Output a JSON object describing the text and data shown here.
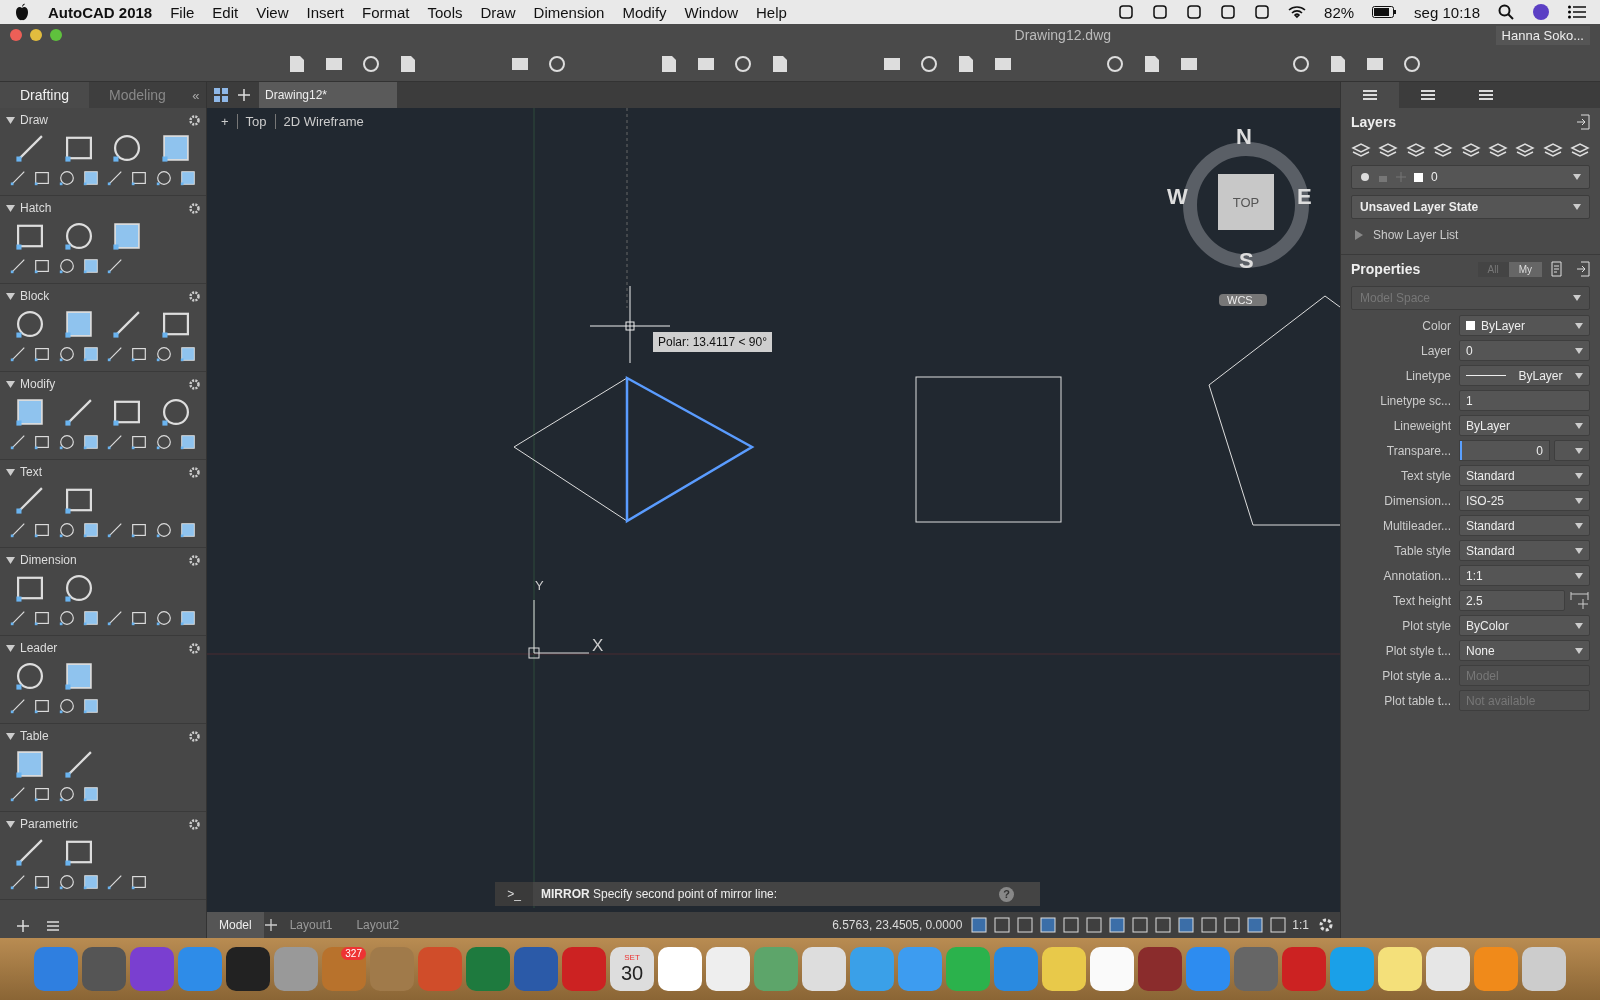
{
  "menu_bar": {
    "app": "AutoCAD 2018",
    "items": [
      "File",
      "Edit",
      "View",
      "Insert",
      "Format",
      "Tools",
      "Draw",
      "Dimension",
      "Modify",
      "Window",
      "Help"
    ],
    "battery": "82%",
    "clock": "seg 10:18"
  },
  "window": {
    "title": "Drawing12.dwg",
    "user": "Hanna Soko..."
  },
  "palette": {
    "tabs": [
      {
        "label": "Drafting",
        "selected": true
      },
      {
        "label": "Modeling",
        "selected": false
      }
    ],
    "collapse": "«",
    "sections": [
      {
        "title": "Draw",
        "expanded": true
      },
      {
        "title": "Hatch",
        "expanded": true
      },
      {
        "title": "Block",
        "expanded": true
      },
      {
        "title": "Modify",
        "expanded": true
      },
      {
        "title": "Text",
        "expanded": true
      },
      {
        "title": "Dimension",
        "expanded": true
      },
      {
        "title": "Leader",
        "expanded": true
      },
      {
        "title": "Table",
        "expanded": true
      },
      {
        "title": "Parametric",
        "expanded": true
      }
    ]
  },
  "file_tabs": [
    {
      "label": "Drawing12*",
      "selected": true
    }
  ],
  "viewport": {
    "controls": [
      "+",
      "Top",
      "2D Wireframe"
    ],
    "compass": {
      "north": "N",
      "south": "S",
      "east": "E",
      "west": "W",
      "face": "TOP",
      "ucs": "WCS"
    },
    "tooltip": "Polar: 13.4117 < 90°",
    "ucs_x": "X",
    "ucs_y": "Y"
  },
  "command_line": {
    "prompt": ">_",
    "text": "**MIRROR** Specify second point of mirror line:",
    "help": "?"
  },
  "layout_tabs": [
    {
      "label": "Model",
      "selected": true
    },
    {
      "label": "Layout1",
      "selected": false
    },
    {
      "label": "Layout2",
      "selected": false
    }
  ],
  "status_bar": {
    "coordinates": "6.5763, 23.4505, 0.0000",
    "scale": "1:1"
  },
  "layers": {
    "title": "Layers",
    "current_layer": "0",
    "layer_state": "Unsaved Layer State",
    "show_list": "Show Layer List"
  },
  "properties": {
    "title": "Properties",
    "filters": [
      {
        "label": "All",
        "selected": false
      },
      {
        "label": "My",
        "selected": true
      }
    ],
    "space": "Model Space",
    "rows": [
      {
        "label": "Color",
        "value": "ByLayer",
        "kind": "color"
      },
      {
        "label": "Layer",
        "value": "0",
        "kind": "dropdown"
      },
      {
        "label": "Linetype",
        "value": "ByLayer",
        "kind": "linetype"
      },
      {
        "label": "Linetype sc...",
        "value": "1",
        "kind": "text"
      },
      {
        "label": "Lineweight",
        "value": "ByLayer",
        "kind": "dropdown"
      },
      {
        "label": "Transpare...",
        "value": "0",
        "kind": "slider",
        "level": 0
      },
      {
        "label": "Text style",
        "value": "Standard",
        "kind": "dropdown"
      },
      {
        "label": "Dimension...",
        "value": "ISO-25",
        "kind": "dropdown"
      },
      {
        "label": "Multileader...",
        "value": "Standard",
        "kind": "dropdown"
      },
      {
        "label": "Table style",
        "value": "Standard",
        "kind": "dropdown"
      },
      {
        "label": "Annotation...",
        "value": "1:1",
        "kind": "dropdown"
      },
      {
        "label": "Text height",
        "value": "2.5",
        "kind": "pick"
      },
      {
        "label": "Plot style",
        "value": "ByColor",
        "kind": "dropdown"
      },
      {
        "label": "Plot style t...",
        "value": "None",
        "kind": "dropdown"
      },
      {
        "label": "Plot style a...",
        "value": "Model",
        "kind": "disabled"
      },
      {
        "label": "Plot table t...",
        "value": "Not available",
        "kind": "disabled"
      }
    ]
  },
  "dock": {
    "badge": "327",
    "calendar_month": "SET",
    "calendar_day": "30"
  }
}
